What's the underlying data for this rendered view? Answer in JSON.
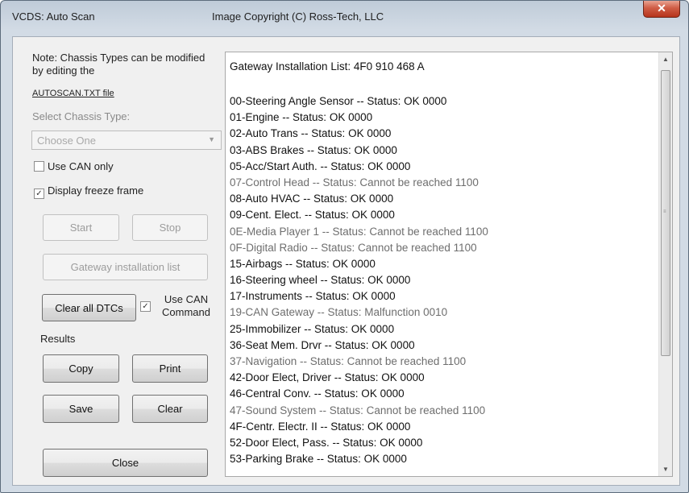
{
  "window": {
    "title": "VCDS: Auto Scan",
    "copyright": "Image Copyright (C) Ross-Tech, LLC",
    "close_glyph": "✕"
  },
  "left": {
    "note": "Note:  Chassis Types can be modified by editing the",
    "link": "AUTOSCAN.TXT file",
    "select_label": "Select Chassis Type:",
    "select_value": "Choose One",
    "use_can_only": {
      "label": "Use CAN only",
      "checked": false
    },
    "display_freeze": {
      "label": "Display freeze frame",
      "checked": true,
      "check_glyph": "✓"
    },
    "start": "Start",
    "stop": "Stop",
    "gateway": "Gateway installation list",
    "clear_dtcs": "Clear all DTCs",
    "use_can_command": {
      "label": "Use CAN Command",
      "checked": true,
      "check_glyph": "✓"
    },
    "results_label": "Results",
    "copy": "Copy",
    "print": "Print",
    "save": "Save",
    "clear": "Clear",
    "close": "Close"
  },
  "list": {
    "header": "Gateway Installation List:  4F0 910 468 A",
    "items": [
      {
        "text": "00-Steering Angle Sensor -- Status: OK 0000",
        "status": "ok"
      },
      {
        "text": "01-Engine -- Status: OK 0000",
        "status": "ok"
      },
      {
        "text": "02-Auto Trans -- Status: OK 0000",
        "status": "ok"
      },
      {
        "text": "03-ABS Brakes -- Status: OK 0000",
        "status": "ok"
      },
      {
        "text": "05-Acc/Start Auth. -- Status: OK 0000",
        "status": "ok"
      },
      {
        "text": "07-Control Head -- Status: Cannot be reached 1100",
        "status": "warn"
      },
      {
        "text": "08-Auto HVAC -- Status: OK 0000",
        "status": "ok"
      },
      {
        "text": "09-Cent. Elect. -- Status: OK 0000",
        "status": "ok"
      },
      {
        "text": "0E-Media Player 1 -- Status: Cannot be reached 1100",
        "status": "warn"
      },
      {
        "text": "0F-Digital Radio -- Status: Cannot be reached 1100",
        "status": "warn"
      },
      {
        "text": "15-Airbags -- Status: OK 0000",
        "status": "ok"
      },
      {
        "text": "16-Steering wheel -- Status: OK 0000",
        "status": "ok"
      },
      {
        "text": "17-Instruments -- Status: OK 0000",
        "status": "ok"
      },
      {
        "text": "19-CAN Gateway -- Status: Malfunction 0010",
        "status": "warn"
      },
      {
        "text": "25-Immobilizer -- Status: OK 0000",
        "status": "ok"
      },
      {
        "text": "36-Seat Mem. Drvr -- Status: OK 0000",
        "status": "ok"
      },
      {
        "text": "37-Navigation -- Status: Cannot be reached 1100",
        "status": "warn"
      },
      {
        "text": "42-Door Elect, Driver -- Status: OK 0000",
        "status": "ok"
      },
      {
        "text": "46-Central Conv. -- Status: OK 0000",
        "status": "ok"
      },
      {
        "text": "47-Sound System -- Status: Cannot be reached 1100",
        "status": "warn"
      },
      {
        "text": "4F-Centr. Electr. II -- Status: OK 0000",
        "status": "ok"
      },
      {
        "text": "52-Door Elect, Pass. -- Status: OK 0000",
        "status": "ok"
      },
      {
        "text": "53-Parking Brake -- Status: OK 0000",
        "status": "ok"
      }
    ]
  },
  "scrollbar": {
    "up_glyph": "▲",
    "down_glyph": "▼",
    "grip_glyph": "≡"
  },
  "colors": {
    "ok_text": "#111111",
    "warn_text": "#6e6e6e",
    "disabled_text": "#9c9c9c"
  }
}
